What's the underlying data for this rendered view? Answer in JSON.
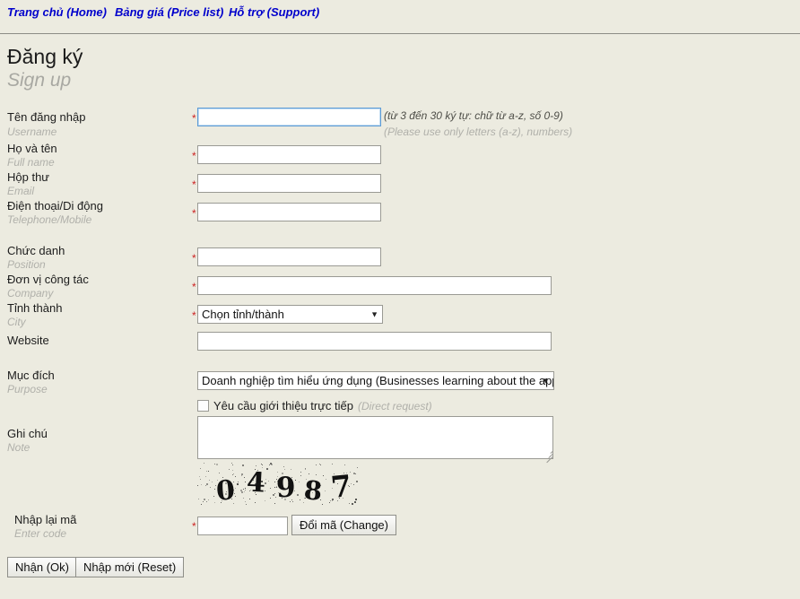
{
  "nav": {
    "items": [
      {
        "label": "Trang chủ (Home)"
      },
      {
        "label": "Bảng giá (Price list)"
      },
      {
        "label": "Hỗ trợ (Support)"
      }
    ]
  },
  "page": {
    "title_vi": "Đăng ký",
    "title_en": "Sign up"
  },
  "form": {
    "username": {
      "label_vi": "Tên đăng nhập",
      "label_en": "Username",
      "value": "",
      "hint_vi": "(từ 3 đến 30 ký tự: chữ từ a-z, số 0-9)",
      "hint_en": "(Please use only letters (a-z), numbers)",
      "required_mark": "*"
    },
    "fullname": {
      "label_vi": "Họ và tên",
      "label_en": "Full name",
      "value": "",
      "required_mark": "*"
    },
    "email": {
      "label_vi": "Hộp thư",
      "label_en": "Email",
      "value": "",
      "required_mark": "*"
    },
    "phone": {
      "label_vi": "Điện thoại/Di động",
      "label_en": "Telephone/Mobile",
      "value": "",
      "required_mark": "*"
    },
    "position": {
      "label_vi": "Chức danh",
      "label_en": "Position",
      "value": "",
      "required_mark": "*"
    },
    "company": {
      "label_vi": "Đơn vị công tác",
      "label_en": "Company",
      "value": "",
      "required_mark": "*"
    },
    "city": {
      "label_vi": "Tỉnh thành",
      "label_en": "City",
      "selected": "Chọn tỉnh/thành",
      "required_mark": "*",
      "caret": "▼"
    },
    "website": {
      "label_vi": "Website",
      "label_en": "",
      "value": ""
    },
    "purpose": {
      "label_vi": "Mục đích",
      "label_en": "Purpose",
      "selected": "Doanh nghiệp tìm hiểu ứng dụng (Businesses learning about the applic",
      "caret": "▼"
    },
    "direct_request": {
      "label_vi": "Yêu cầu giới thiệu trực tiếp",
      "label_en": "(Direct request)",
      "checked": false
    },
    "note": {
      "label_vi": "Ghi chú",
      "label_en": "Note",
      "value": ""
    },
    "captcha": {
      "code": "04987",
      "label_vi": "Nhập lại mã",
      "label_en": "Enter code",
      "value": "",
      "required_mark": "*",
      "change_button": "Đổi mã (Change)"
    }
  },
  "actions": {
    "submit": "Nhận (Ok)",
    "reset": "Nhập mới (Reset)"
  },
  "colors": {
    "background": "#ecebe0",
    "nav_link": "#0000cc",
    "required": "#cc2222",
    "sub_label": "#b0b0aa",
    "focus_border": "#5d9bd5"
  }
}
